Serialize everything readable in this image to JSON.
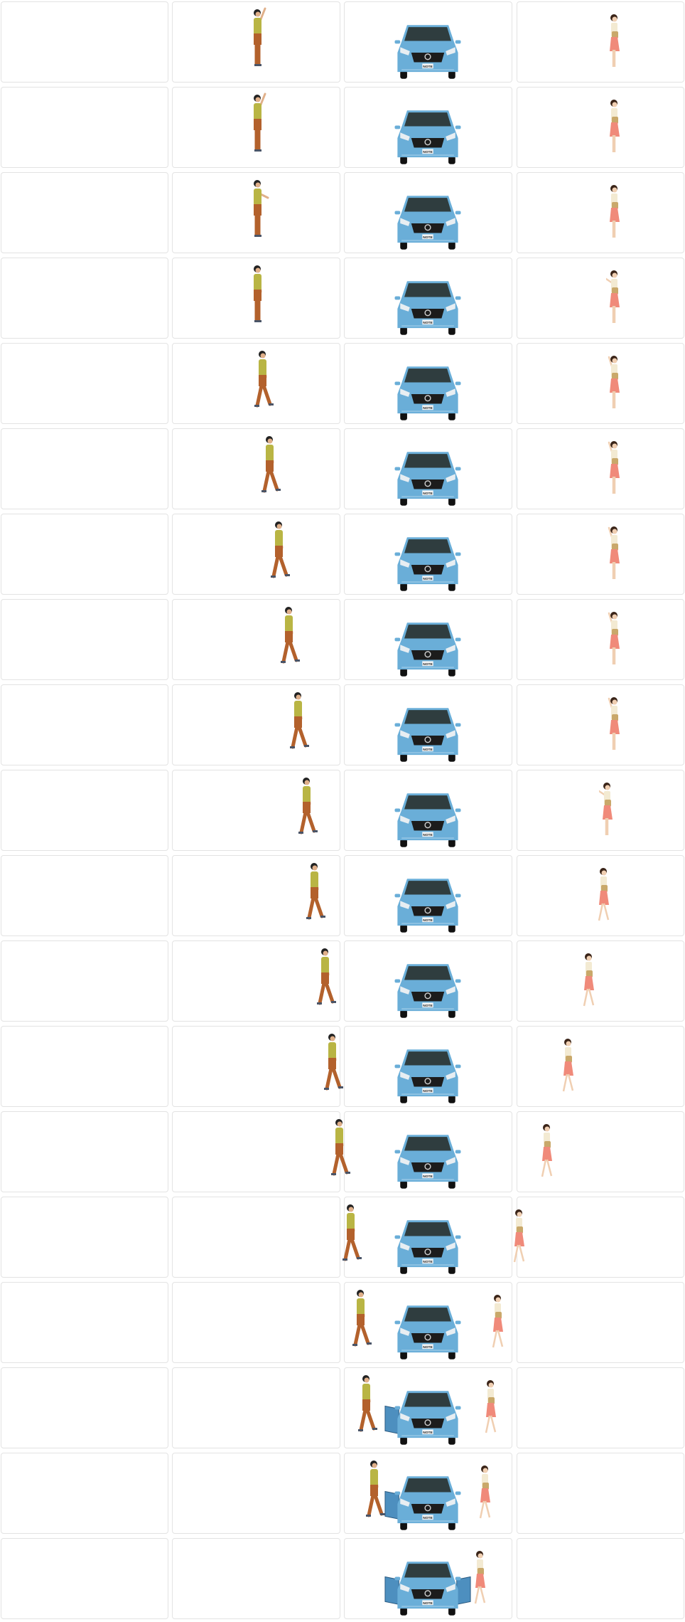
{
  "colors": {
    "car": "#6aaed8",
    "shirt": "#b9b544",
    "pants": "#b3612c",
    "skirt": "#f08a7a",
    "top": "#f3ead2",
    "bag": "#c9a86a"
  },
  "car_plate": "NOTE",
  "frames": [
    {
      "man": "wave-high",
      "woman": "stand",
      "car": "closed"
    },
    {
      "man": "wave-high",
      "woman": "stand",
      "car": "closed"
    },
    {
      "man": "wave-mid",
      "woman": "stand",
      "car": "closed"
    },
    {
      "man": "stand",
      "woman": "wave-low",
      "car": "closed"
    },
    {
      "man": "walk",
      "woman": "wave-high",
      "car": "closed"
    },
    {
      "man": "walk",
      "woman": "wave-high",
      "car": "closed"
    },
    {
      "man": "walk",
      "woman": "wave-high",
      "car": "closed"
    },
    {
      "man": "walk",
      "woman": "wave-high",
      "car": "closed"
    },
    {
      "man": "walk",
      "woman": "wave-high",
      "car": "closed"
    },
    {
      "man": "walk",
      "woman": "wave-mid",
      "car": "closed"
    },
    {
      "man": "walk",
      "woman": "walk",
      "car": "closed"
    },
    {
      "man": "walk",
      "woman": "walk",
      "car": "closed"
    },
    {
      "man": "walk",
      "woman": "walk",
      "car": "closed"
    },
    {
      "man": "walk",
      "woman": "walk",
      "car": "closed"
    },
    {
      "man": "walk",
      "woman": "walk",
      "car": "closed"
    },
    {
      "man": "walk",
      "woman": "walk",
      "car": "closed"
    },
    {
      "man": "walk",
      "woman": "walk",
      "car": "left-door-open"
    },
    {
      "man": "enter",
      "woman": "walk",
      "car": "left-door-open"
    },
    {
      "man": "hidden",
      "woman": "enter",
      "car": "both-doors-open"
    }
  ]
}
